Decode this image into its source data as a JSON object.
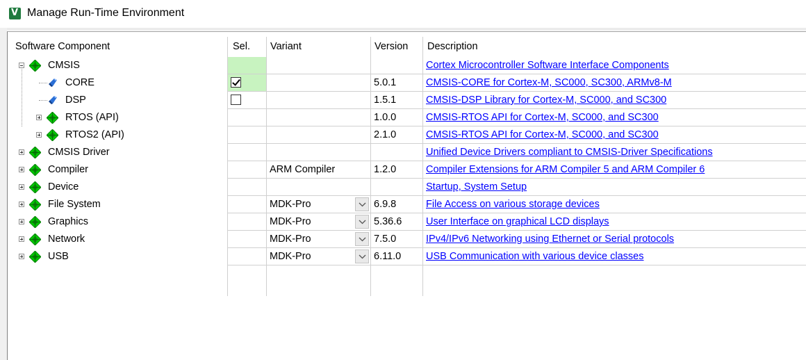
{
  "window": {
    "title": "Manage Run-Time Environment"
  },
  "columns": {
    "component": "Software Component",
    "sel": "Sel.",
    "variant": "Variant",
    "version": "Version",
    "description": "Description"
  },
  "rows": [
    {
      "name": "CMSIS",
      "level": 0,
      "expander": "minus",
      "icon": "green-diamond-icon",
      "sel": "",
      "variant": "",
      "version": "",
      "description": "Cortex Microcontroller Software Interface Components"
    },
    {
      "name": "CORE",
      "level": 1,
      "expander": "",
      "icon": "blue-gem-icon",
      "sel": "checked",
      "variant": "",
      "version": "5.0.1",
      "description": "CMSIS-CORE for Cortex-M, SC000, SC300, ARMv8-M"
    },
    {
      "name": "DSP",
      "level": 1,
      "expander": "",
      "icon": "blue-gem-icon",
      "sel": "unchecked",
      "variant": "",
      "version": "1.5.1",
      "description": "CMSIS-DSP Library for Cortex-M, SC000, and SC300"
    },
    {
      "name": "RTOS (API)",
      "level": 1,
      "expander": "plus",
      "icon": "green-diamond-icon",
      "sel": "",
      "variant": "",
      "version": "1.0.0",
      "description": "CMSIS-RTOS API for Cortex-M, SC000, and SC300"
    },
    {
      "name": "RTOS2 (API)",
      "level": 1,
      "expander": "plus",
      "icon": "green-diamond-icon",
      "sel": "",
      "variant": "",
      "version": "2.1.0",
      "description": "CMSIS-RTOS API for Cortex-M, SC000, and SC300"
    },
    {
      "name": "CMSIS Driver",
      "level": 0,
      "expander": "plus",
      "icon": "green-diamond-icon",
      "sel": "",
      "variant": "",
      "version": "",
      "description": "Unified Device Drivers compliant to CMSIS-Driver Specifications"
    },
    {
      "name": "Compiler",
      "level": 0,
      "expander": "plus",
      "icon": "green-diamond-icon",
      "sel": "",
      "variant": "ARM Compiler",
      "version": "1.2.0",
      "description": "Compiler Extensions for ARM Compiler 5 and ARM Compiler 6"
    },
    {
      "name": "Device",
      "level": 0,
      "expander": "plus",
      "icon": "green-diamond-icon",
      "sel": "",
      "variant": "",
      "version": "",
      "description": "Startup, System Setup"
    },
    {
      "name": "File System",
      "level": 0,
      "expander": "plus",
      "icon": "green-diamond-icon",
      "sel": "",
      "variant": "MDK-Pro",
      "dropdown": true,
      "version": "6.9.8",
      "description": "File Access on various storage devices"
    },
    {
      "name": "Graphics",
      "level": 0,
      "expander": "plus",
      "icon": "green-diamond-icon",
      "sel": "",
      "variant": "MDK-Pro",
      "dropdown": true,
      "version": "5.36.6",
      "description": "User Interface on graphical LCD displays"
    },
    {
      "name": "Network",
      "level": 0,
      "expander": "plus",
      "icon": "green-diamond-icon",
      "sel": "",
      "variant": "MDK-Pro",
      "dropdown": true,
      "version": "7.5.0",
      "description": "IPv4/IPv6 Networking using Ethernet or Serial protocols"
    },
    {
      "name": "USB",
      "level": 0,
      "expander": "plus",
      "icon": "green-diamond-icon",
      "sel": "",
      "variant": "MDK-Pro",
      "dropdown": true,
      "version": "6.11.0",
      "description": "USB Communication with various device classes"
    }
  ],
  "colors": {
    "link": "#0000ff",
    "selected_cell": "#c8f3c0",
    "diamond": "#00c800"
  }
}
